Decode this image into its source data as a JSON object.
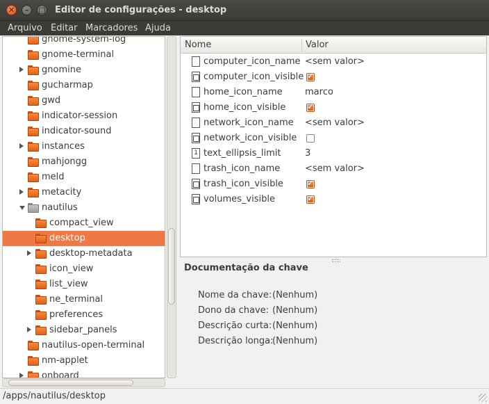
{
  "window": {
    "title": "Editor de configurações - desktop",
    "close_glyph": "✕",
    "minimize_glyph": "–",
    "maximize_glyph": "□"
  },
  "menubar": {
    "items": [
      "Arquivo",
      "Editar",
      "Marcadores",
      "Ajuda"
    ]
  },
  "tree": {
    "items": [
      {
        "label": "gnome-system-log",
        "expander": "none",
        "indent": 0
      },
      {
        "label": "gnome-terminal",
        "expander": "none",
        "indent": 0
      },
      {
        "label": "gnomine",
        "expander": "right",
        "indent": 0
      },
      {
        "label": "gucharmap",
        "expander": "none",
        "indent": 0
      },
      {
        "label": "gwd",
        "expander": "none",
        "indent": 0
      },
      {
        "label": "indicator-session",
        "expander": "none",
        "indent": 0
      },
      {
        "label": "indicator-sound",
        "expander": "none",
        "indent": 0
      },
      {
        "label": "instances",
        "expander": "right",
        "indent": 0
      },
      {
        "label": "mahjongg",
        "expander": "none",
        "indent": 0
      },
      {
        "label": "meld",
        "expander": "none",
        "indent": 0
      },
      {
        "label": "metacity",
        "expander": "right",
        "indent": 0
      },
      {
        "label": "nautilus",
        "expander": "down",
        "indent": 0,
        "icon": "gray"
      },
      {
        "label": "compact_view",
        "expander": "none",
        "indent": 1
      },
      {
        "label": "desktop",
        "expander": "none",
        "indent": 1,
        "selected": true
      },
      {
        "label": "desktop-metadata",
        "expander": "right",
        "indent": 1
      },
      {
        "label": "icon_view",
        "expander": "none",
        "indent": 1
      },
      {
        "label": "list_view",
        "expander": "none",
        "indent": 1
      },
      {
        "label": "ne_terminal",
        "expander": "none",
        "indent": 1
      },
      {
        "label": "preferences",
        "expander": "none",
        "indent": 1
      },
      {
        "label": "sidebar_panels",
        "expander": "right",
        "indent": 1
      },
      {
        "label": "nautilus-open-terminal",
        "expander": "none",
        "indent": 0
      },
      {
        "label": "nm-applet",
        "expander": "none",
        "indent": 0
      },
      {
        "label": "onboard",
        "expander": "right",
        "indent": 0
      }
    ]
  },
  "keys": {
    "header_name": "Nome",
    "header_value": "Valor",
    "rows": [
      {
        "name": "computer_icon_name",
        "type": "string",
        "value": "<sem valor>"
      },
      {
        "name": "computer_icon_visible",
        "type": "bool",
        "checked": true
      },
      {
        "name": "home_icon_name",
        "type": "string",
        "value": "marco"
      },
      {
        "name": "home_icon_visible",
        "type": "bool",
        "checked": true
      },
      {
        "name": "network_icon_name",
        "type": "string",
        "value": "<sem valor>"
      },
      {
        "name": "network_icon_visible",
        "type": "bool",
        "checked": false
      },
      {
        "name": "text_ellipsis_limit",
        "type": "int",
        "value": "3"
      },
      {
        "name": "trash_icon_name",
        "type": "string",
        "value": "<sem valor>"
      },
      {
        "name": "trash_icon_visible",
        "type": "bool",
        "checked": true
      },
      {
        "name": "volumes_visible",
        "type": "bool",
        "checked": true
      }
    ],
    "type_glyphs": {
      "string": "",
      "bool": "",
      "int": "1"
    }
  },
  "doc": {
    "title": "Documentação da chave",
    "fields": [
      {
        "label": "Nome da chave:",
        "value": "(Nenhum)"
      },
      {
        "label": "Dono da chave:",
        "value": "(Nenhum)"
      },
      {
        "label": "Descrição curta:",
        "value": "(Nenhum)"
      },
      {
        "label": "Descrição longa:",
        "value": "(Nenhum)"
      }
    ]
  },
  "status": {
    "path": "/apps/nautilus/desktop"
  },
  "colors": {
    "accent": "#f07746",
    "titlebar": "#3c3b37"
  }
}
